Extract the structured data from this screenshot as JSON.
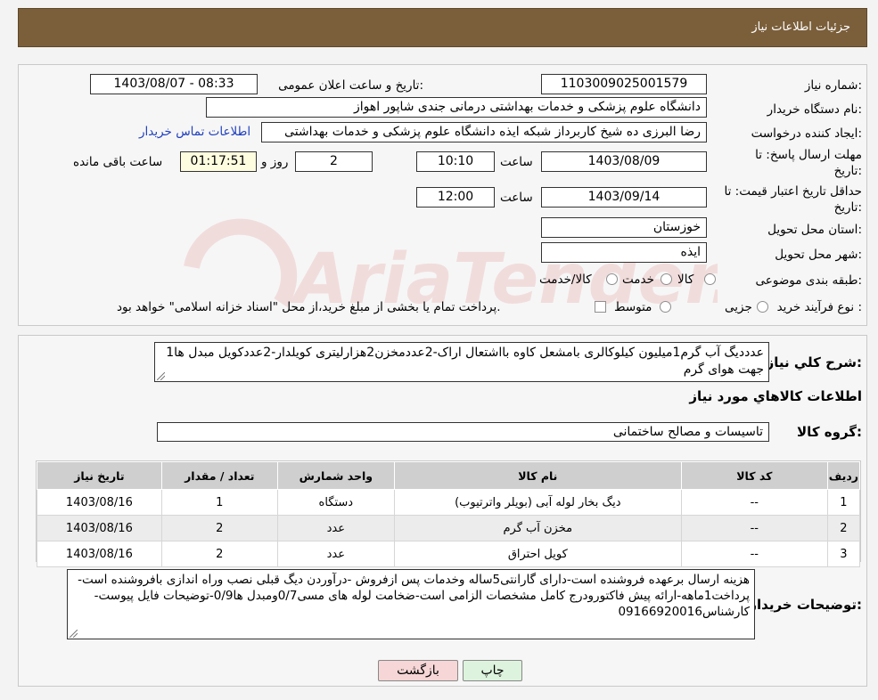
{
  "header": {
    "title": "جزئیات اطلاعات نیاز"
  },
  "form": {
    "need_number_label": "شماره نیاز:",
    "need_number": "1103009025001579",
    "announce_label": "تاریخ و ساعت اعلان عمومی:",
    "announce_value": "1403/08/07 - 08:33",
    "buyer_org_label": "نام دستگاه خریدار:",
    "buyer_org": "دانشگاه علوم پزشکی و خدمات بهداشتی درمانی جندی شاپور اهواز",
    "requester_label": "ایجاد کننده درخواست:",
    "requester": "رضا البرزی ده شیخ کاربرداز شبکه ایذه دانشگاه علوم پزشکی و خدمات بهداشتی",
    "contact_link": "اطلاعات تماس خریدار",
    "deadline_label_1": "مهلت ارسال پاسخ: تا",
    "deadline_label_2": "تاریخ:",
    "deadline_date": "1403/08/09",
    "time_label": "ساعت",
    "deadline_time": "10:10",
    "days_value": "2",
    "days_label": "روز و",
    "remaining_time": "01:17:51",
    "remaining_label": "ساعت باقی مانده",
    "validity_label_1": "حداقل تاریخ اعتبار قیمت: تا",
    "validity_label_2": "تاریخ:",
    "validity_date": "1403/09/14",
    "validity_time_label": "ساعت",
    "validity_time": "12:00",
    "province_label": "استان محل تحویل:",
    "province": "خوزستان",
    "city_label": "شهر محل تحویل:",
    "city": "ایذه",
    "category_label": "طبقه بندی موضوعی:",
    "category_options": [
      "کالا",
      "خدمت",
      "کالا/خدمت"
    ],
    "process_label": "نوع فرآیند خرید :",
    "process_options": [
      "جزیی",
      "متوسط"
    ],
    "process_note": "پرداخت تمام یا بخشی از مبلغ خرید،از محل \"اسناد خزانه اسلامی\" خواهد بود."
  },
  "details": {
    "summary_label": "شرح کلي نياز:",
    "summary_text": "1عدددیگ آب گرم1میلیون کیلوکالری بامشعل کاوه بااشتعال اراک-2عددمخزن2هزارلیتری کویلدار-2عددکویل مبدل ها جهت هوای گرم",
    "goods_info_title": "اطلاعات کالاهاي مورد نياز",
    "goods_group_label": "گروه کالا:",
    "goods_group": "تاسیسات و مصالح ساختمانی",
    "table": {
      "headers": [
        "ردیف",
        "کد کالا",
        "نام کالا",
        "واحد شمارش",
        "تعداد / مقدار",
        "تاریخ نیاز"
      ],
      "rows": [
        {
          "row": "1",
          "code": "--",
          "name": "دیگ بخار لوله آبی (بویلر واترتیوب)",
          "unit": "دستگاه",
          "qty": "1",
          "date": "1403/08/16"
        },
        {
          "row": "2",
          "code": "--",
          "name": "مخزن آب گرم",
          "unit": "عدد",
          "qty": "2",
          "date": "1403/08/16"
        },
        {
          "row": "3",
          "code": "--",
          "name": "کویل احتراق",
          "unit": "عدد",
          "qty": "2",
          "date": "1403/08/16"
        }
      ]
    },
    "buyer_notes_label": "توضیحات خریدار:",
    "buyer_notes": "هزینه ارسال برعهده فروشنده است-دارای گارانتی5ساله وخدمات پس ازفروش -درآوردن دیگ قبلی نصب وراه اندازی بافروشنده است-پرداخت1ماهه-ارائه پیش فاکتورودرج کامل مشخصات الزامی است-ضخامت لوله های مسی0/7ومبدل ها0/9-توضیحات فایل پیوست-کارشناس09166920016"
  },
  "buttons": {
    "print": "چاپ",
    "back": "بازگشت"
  },
  "watermark": {
    "text": "AriaTender.neT"
  },
  "colors": {
    "header_bg": "#7b5f3b",
    "link": "#1f3fbf",
    "back_button_bg": "#f6d6d6",
    "print_button_bg": "#ddf3dd"
  }
}
